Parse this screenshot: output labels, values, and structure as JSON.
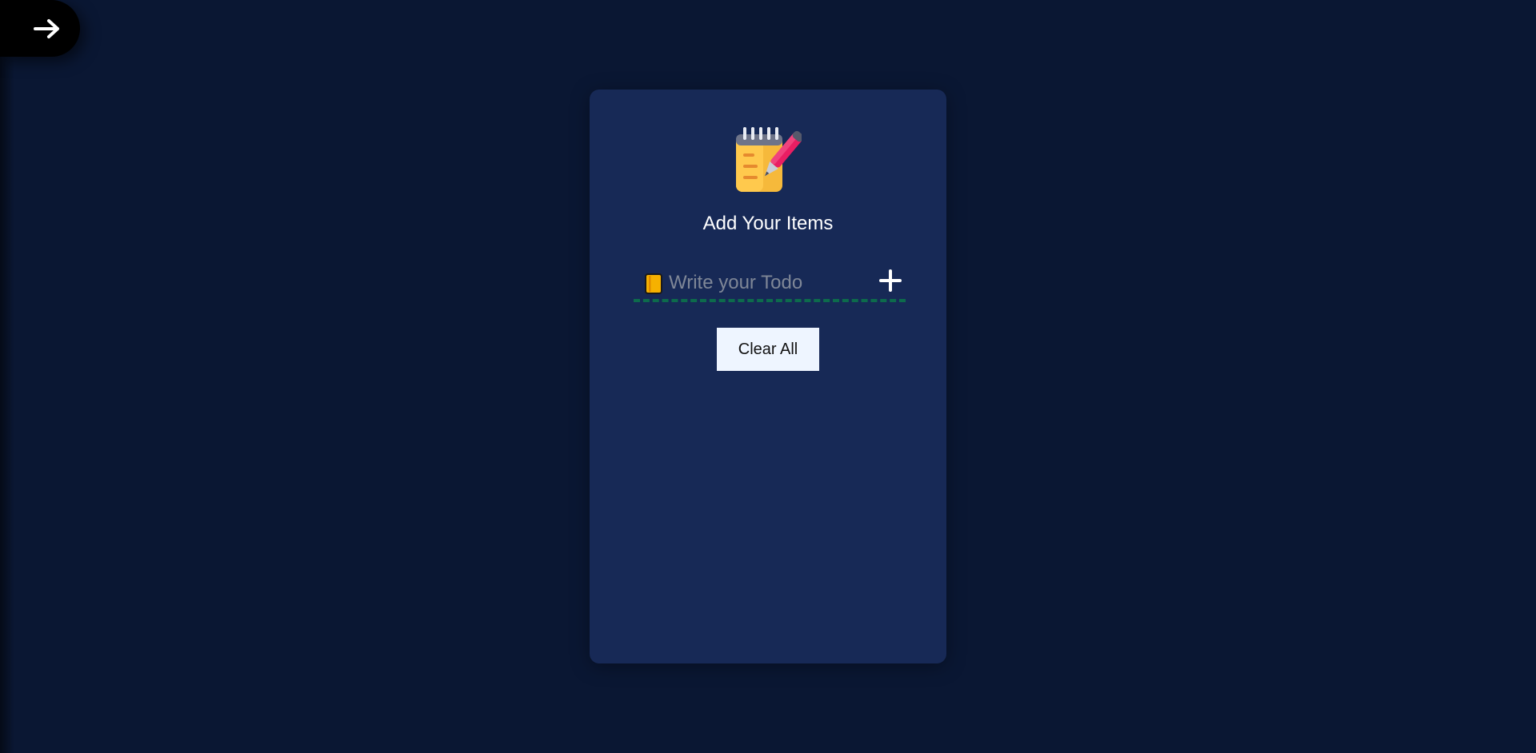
{
  "toggle": {
    "icon": "arrow-right-icon"
  },
  "card": {
    "logo_icon": "notepad-pen-icon",
    "title": "Add Your Items",
    "input": {
      "placeholder": "Write your Todo",
      "value": "",
      "leading_icon": "notebook-icon",
      "add_icon": "plus-icon"
    },
    "clear_button_label": "Clear All",
    "items": []
  },
  "colors": {
    "page_background": "#0a1733",
    "card_background": "#172956",
    "underline": "#0d6b4c",
    "button_background": "#eef5ff"
  }
}
